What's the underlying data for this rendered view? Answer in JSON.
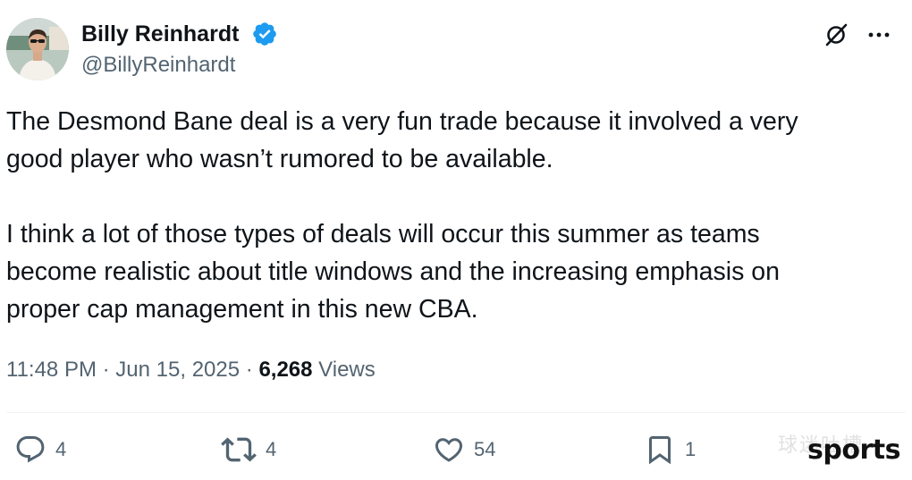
{
  "author": {
    "display_name": "Billy Reinhardt",
    "handle": "@BillyReinhardt",
    "verified": true
  },
  "tweet": {
    "paragraphs": [
      "The Desmond Bane deal is a very fun trade because it involved a very\ngood player who wasn’t rumored to be available.",
      "I think a lot of those types of deals will occur this summer as teams\nbecome realistic about title windows and the increasing emphasis on\nproper cap management in this new CBA."
    ],
    "time": "11:48 PM",
    "separator": "·",
    "date": "Jun 15, 2025",
    "views_count": "6,268",
    "views_label": "Views"
  },
  "actions": {
    "replies": "4",
    "reposts": "4",
    "likes": "54",
    "bookmarks": "1"
  },
  "icons": {
    "verified": "verified-badge-icon",
    "grok": "grok-icon",
    "more": "more-icon",
    "reply": "reply-icon",
    "repost": "repost-icon",
    "like": "heart-icon",
    "bookmark": "bookmark-icon"
  },
  "watermark": {
    "chinese": "球迷吐槽",
    "brand": "sports"
  },
  "colors": {
    "text": "#0f1419",
    "secondary": "#536471",
    "verified": "#1d9bf0",
    "divider": "#eff3f4"
  }
}
